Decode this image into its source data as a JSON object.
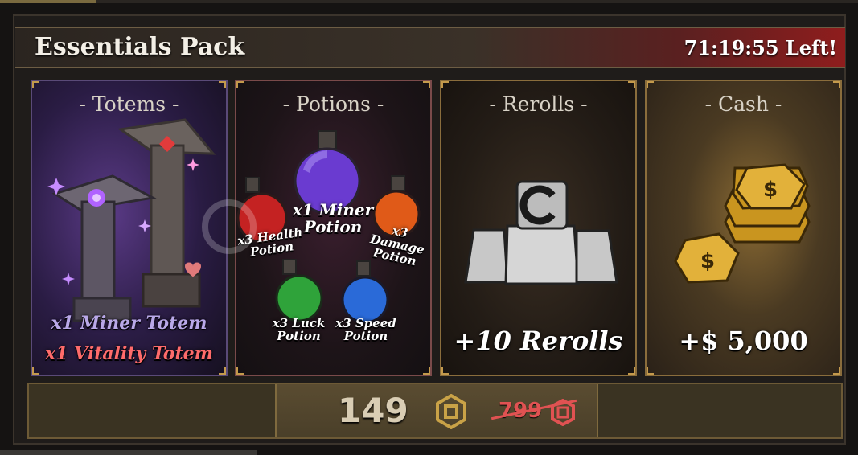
{
  "pack": {
    "title": "Essentials Pack",
    "timer": "71:19:55 Left!"
  },
  "cards": [
    {
      "title": "- Totems -",
      "items": [
        "x1 Miner Totem",
        "x1 Vitality Totem"
      ]
    },
    {
      "title": "- Potions -",
      "items": [
        {
          "label": "x1 Miner Potion"
        },
        {
          "label": "x3 Health Potion"
        },
        {
          "label": "x3 Damage Potion"
        },
        {
          "label": "x3 Luck Potion"
        },
        {
          "label": "x3 Speed Potion"
        }
      ]
    },
    {
      "title": "- Rerolls -",
      "reward": "+10 Rerolls"
    },
    {
      "title": "- Cash -",
      "reward": "+$ 5,000"
    }
  ],
  "purchase": {
    "price": "149",
    "original_price": "799",
    "currency_icon": "robux-icon"
  },
  "colors": {
    "accent": "#c49a4c",
    "timer_bg": "#8f1d1d",
    "strike": "#e05252",
    "totem_miner": "#b9a8e8",
    "totem_vitality": "#ff6b6b"
  }
}
